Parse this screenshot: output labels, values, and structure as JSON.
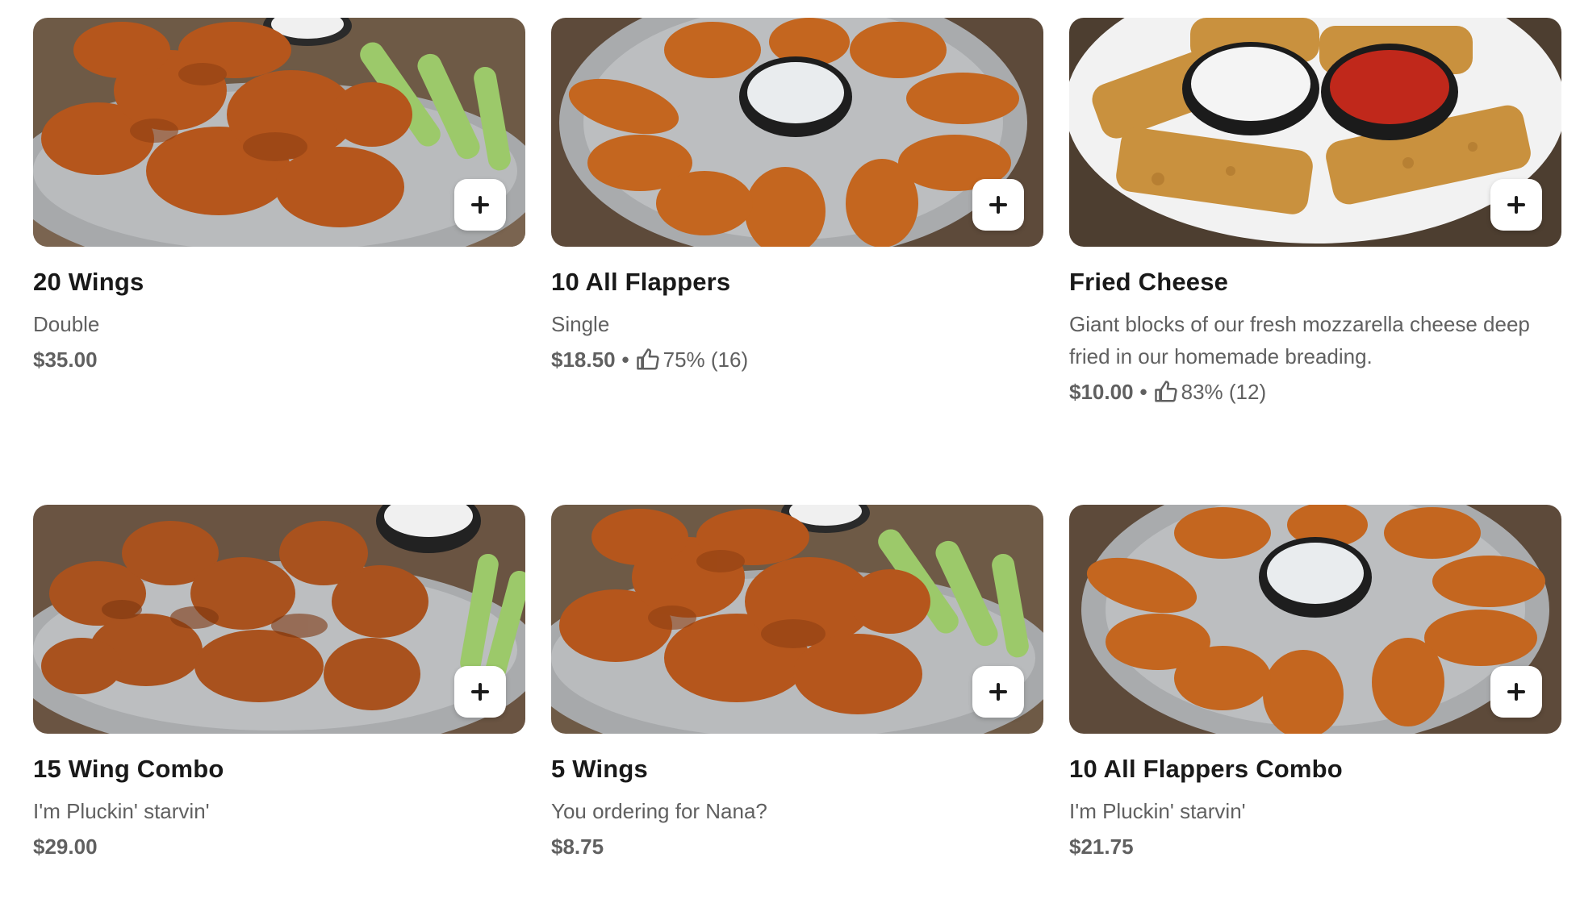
{
  "items": [
    {
      "name": "20 Wings",
      "description": "Double",
      "price": "$35.00",
      "rating": "",
      "add_label": "+"
    },
    {
      "name": "10 All Flappers",
      "description": "Single",
      "price": "$18.50",
      "rating": "75% (16)",
      "add_label": "+"
    },
    {
      "name": "Fried Cheese",
      "description": "Giant blocks of our fresh mozzarella cheese deep fried in our homemade breading.",
      "price": "$10.00",
      "rating": "83% (12)",
      "add_label": "+"
    },
    {
      "name": "15 Wing Combo",
      "description": "I'm Pluckin' starvin'",
      "price": "$29.00",
      "rating": "",
      "add_label": "+"
    },
    {
      "name": "5 Wings",
      "description": "You ordering for Nana?",
      "price": "$8.75",
      "rating": "",
      "add_label": "+"
    },
    {
      "name": "10 All Flappers Combo",
      "description": "I'm Pluckin' starvin'",
      "price": "$21.75",
      "rating": "",
      "add_label": "+"
    }
  ],
  "icons": {
    "add": "plus-icon",
    "rating": "thumbs-up-icon"
  },
  "colors": {
    "text_primary": "#191919",
    "text_secondary": "#606060",
    "wing": "#b5561c",
    "celery": "#9cc96a",
    "ranch": "#eeeeee",
    "marinara": "#c0281b"
  }
}
